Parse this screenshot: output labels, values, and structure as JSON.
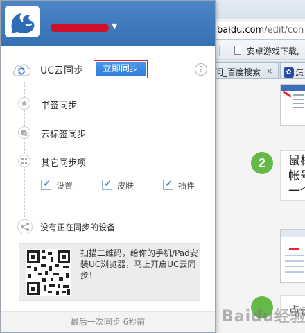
{
  "browser": {
    "address_host": "baidu.com",
    "address_rest": "/edit/con",
    "bookmark_label": "安卓游戏下载,",
    "tab1_label": "问_百度搜索",
    "tab1_close": "×",
    "tab2_icon": "paw-icon",
    "tab2_label": "怎",
    "step2_number": "2",
    "step2_text_lines": [
      "鼠标",
      "帐号",
      "一个"
    ],
    "step3_text": "点击",
    "watermark": "Baidu经验"
  },
  "panel": {
    "accent_color": "#3470b3",
    "account_name_redacted": true,
    "dropdown_icon": "▼",
    "sync_title": "UC云同步",
    "sync_now_label": "立即同步",
    "help_icon": "?",
    "items": [
      {
        "icon": "star-icon",
        "label": "书签同步"
      },
      {
        "icon": "cloud-tabs-icon",
        "label": "云标签同步"
      },
      {
        "icon": "grid-icon",
        "label": "其它同步项"
      }
    ],
    "options": [
      {
        "label": "设置",
        "checked": true
      },
      {
        "label": "皮肤",
        "checked": true
      },
      {
        "label": "插件",
        "checked": true
      }
    ],
    "device_status": "没有正在同步的设备",
    "qr_text": "扫描二维码，给你的手机/Pad安装UC浏览器，马上开启UC云同步！",
    "footer": "最后一次同步 6秒前"
  }
}
